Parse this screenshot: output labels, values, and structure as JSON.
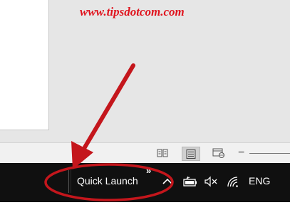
{
  "watermark": {
    "text": "www.tipsdotcom.com",
    "color": "#e0141e"
  },
  "status_bar": {
    "view_buttons": [
      {
        "name": "read-mode-icon",
        "active": false
      },
      {
        "name": "print-layout-icon",
        "active": true
      },
      {
        "name": "web-layout-icon",
        "active": false
      }
    ],
    "zoom_out_label": "−"
  },
  "taskbar": {
    "toolbar_label": "Quick Launch",
    "toolbar_chevron": "»",
    "tray": {
      "show_hidden_icon": "chevron-up-icon",
      "battery_icon": "battery-icon",
      "volume_icon": "volume-muted-icon",
      "network_icon": "wifi-icon",
      "language": "ENG"
    }
  },
  "annotation": {
    "arrow_color": "#c4161c",
    "ellipse_color": "#c4161c"
  }
}
